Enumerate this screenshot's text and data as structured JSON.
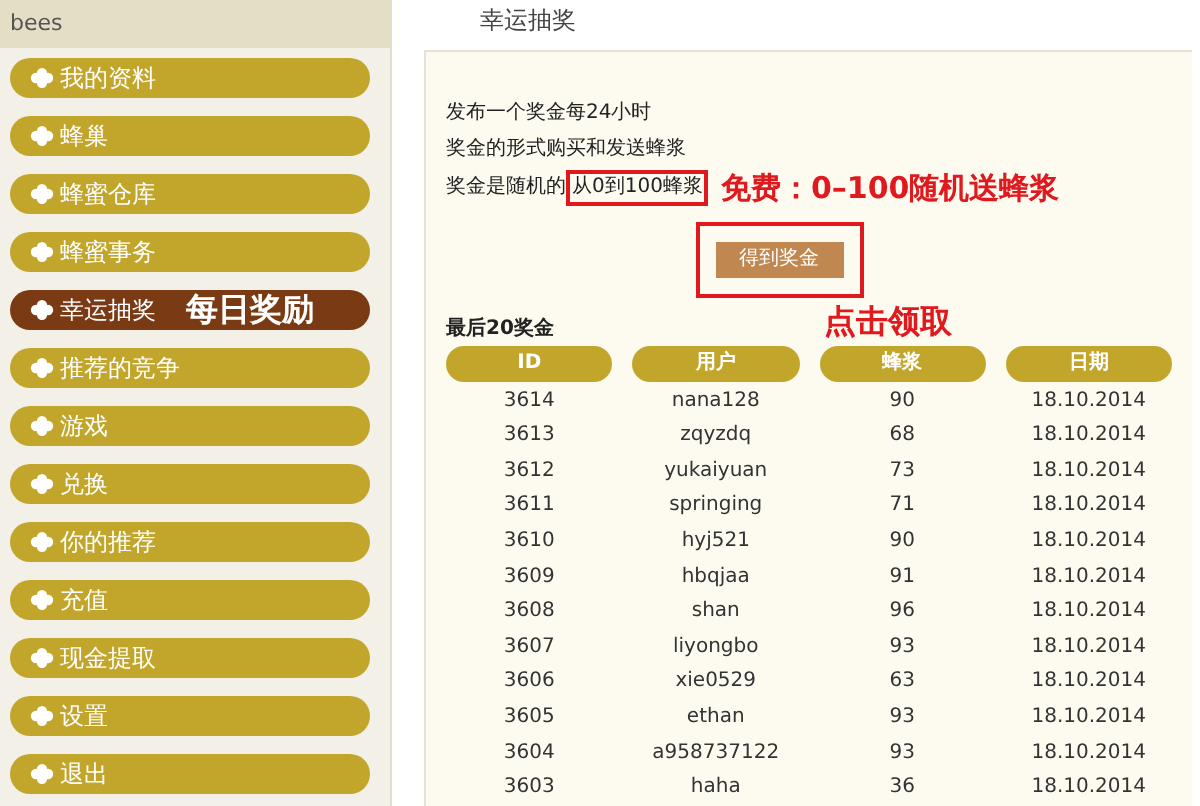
{
  "sidebar": {
    "title": "bees",
    "items": [
      {
        "label": "我的资料",
        "selected": false
      },
      {
        "label": "蜂巢",
        "selected": false
      },
      {
        "label": "蜂蜜仓库",
        "selected": false
      },
      {
        "label": "蜂蜜事务",
        "selected": false
      },
      {
        "label": "幸运抽奖",
        "selected": true,
        "callout": "每日奖励"
      },
      {
        "label": "推荐的竞争",
        "selected": false
      },
      {
        "label": "游戏",
        "selected": false
      },
      {
        "label": "兑换",
        "selected": false
      },
      {
        "label": "你的推荐",
        "selected": false
      },
      {
        "label": "充值",
        "selected": false
      },
      {
        "label": "现金提取",
        "selected": false
      },
      {
        "label": "设置",
        "selected": false
      },
      {
        "label": "退出",
        "selected": false
      }
    ]
  },
  "page_title": "幸运抽奖",
  "info": {
    "line_1": "发布一个奖金每24小时",
    "line_2": "奖金的形式购买和发送蜂浆",
    "line_3_prefix": "奖金是随机的",
    "line_3_highlight": "从0到100蜂浆",
    "callout": "免费：0–100随机送蜂浆"
  },
  "claim_button": {
    "label": "得到奖金",
    "callout": "点击领取"
  },
  "table": {
    "title": "最后20奖金",
    "columns": [
      "ID",
      "用户",
      "蜂浆",
      "日期"
    ],
    "rows": [
      [
        "3614",
        "nana128",
        "90",
        "18.10.2014"
      ],
      [
        "3613",
        "zqyzdq",
        "68",
        "18.10.2014"
      ],
      [
        "3612",
        "yukaiyuan",
        "73",
        "18.10.2014"
      ],
      [
        "3611",
        "springing",
        "71",
        "18.10.2014"
      ],
      [
        "3610",
        "hyj521",
        "90",
        "18.10.2014"
      ],
      [
        "3609",
        "hbqjaa",
        "91",
        "18.10.2014"
      ],
      [
        "3608",
        "shan",
        "96",
        "18.10.2014"
      ],
      [
        "3607",
        "liyongbo",
        "93",
        "18.10.2014"
      ],
      [
        "3606",
        "xie0529",
        "63",
        "18.10.2014"
      ],
      [
        "3605",
        "ethan",
        "93",
        "18.10.2014"
      ],
      [
        "3604",
        "a958737122",
        "93",
        "18.10.2014"
      ],
      [
        "3603",
        "haha",
        "36",
        "18.10.2014"
      ]
    ]
  }
}
